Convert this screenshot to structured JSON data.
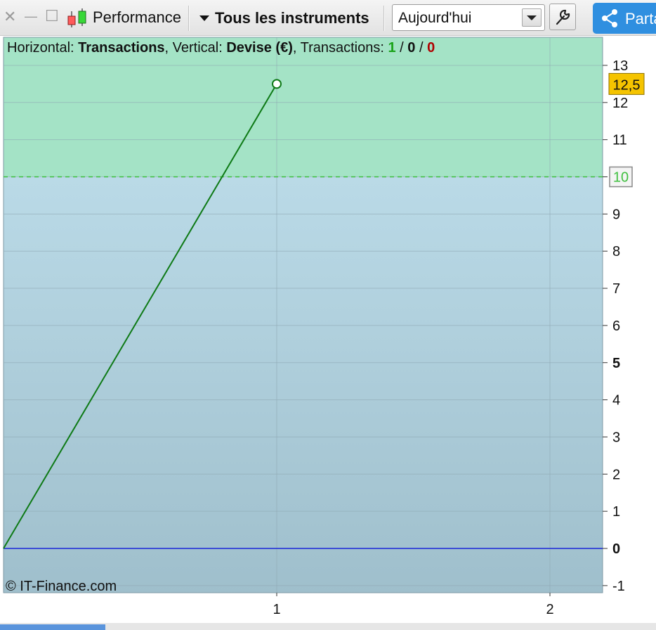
{
  "toolbar": {
    "close_glyph": "✕",
    "minimize_glyph": "—",
    "maximize_glyph": "☐",
    "title": "Performance",
    "instruments_label": "Tous les instruments",
    "period_value": "Aujourd'hui",
    "share_label": "Partager",
    "icons": [
      "close-icon",
      "minimize-icon",
      "maximize-icon",
      "candlestick-icon",
      "caret-down-icon",
      "dropdown-arrow-icon",
      "wrench-icon",
      "share-icon"
    ]
  },
  "chart_header": {
    "horizontal_prefix": "Horizontal: ",
    "horizontal_value": "Transactions",
    "vertical_prefix": ", Vertical: ",
    "vertical_value": "Devise (€)",
    "transactions_prefix": ", Transactions: ",
    "tx_winning": "1",
    "tx_sep1": " / ",
    "tx_neutral": "0",
    "tx_sep2": " / ",
    "tx_losing": "0"
  },
  "copyright": "© IT-Finance.com",
  "colors": {
    "line": "#0e7a16",
    "zero_line": "#1a26d8",
    "reference_line": "#3fbf3f",
    "profit_zone": "#a4e3c6",
    "winning_text": "#1aa31a",
    "losing_text": "#b00000",
    "badge_current": "#f5c400"
  },
  "chart_data": {
    "type": "line",
    "xlabel": "Transactions",
    "ylabel": "Devise (€)",
    "xlim": [
      0,
      2.2
    ],
    "ylim": [
      -1.2,
      13.5
    ],
    "x_ticks": [
      "1",
      "2"
    ],
    "y_ticks": [
      "13",
      "12",
      "11",
      "10",
      "9",
      "8",
      "7",
      "6",
      "5",
      "4",
      "3",
      "2",
      "1",
      "0",
      "-1"
    ],
    "series": [
      {
        "name": "Performance",
        "x": [
          0,
          1
        ],
        "y": [
          0,
          12.5
        ]
      }
    ],
    "reference_value": 10,
    "reference_label": "10",
    "current_value": 12.5,
    "current_label": "12,5",
    "grid": true,
    "legend": "none"
  }
}
